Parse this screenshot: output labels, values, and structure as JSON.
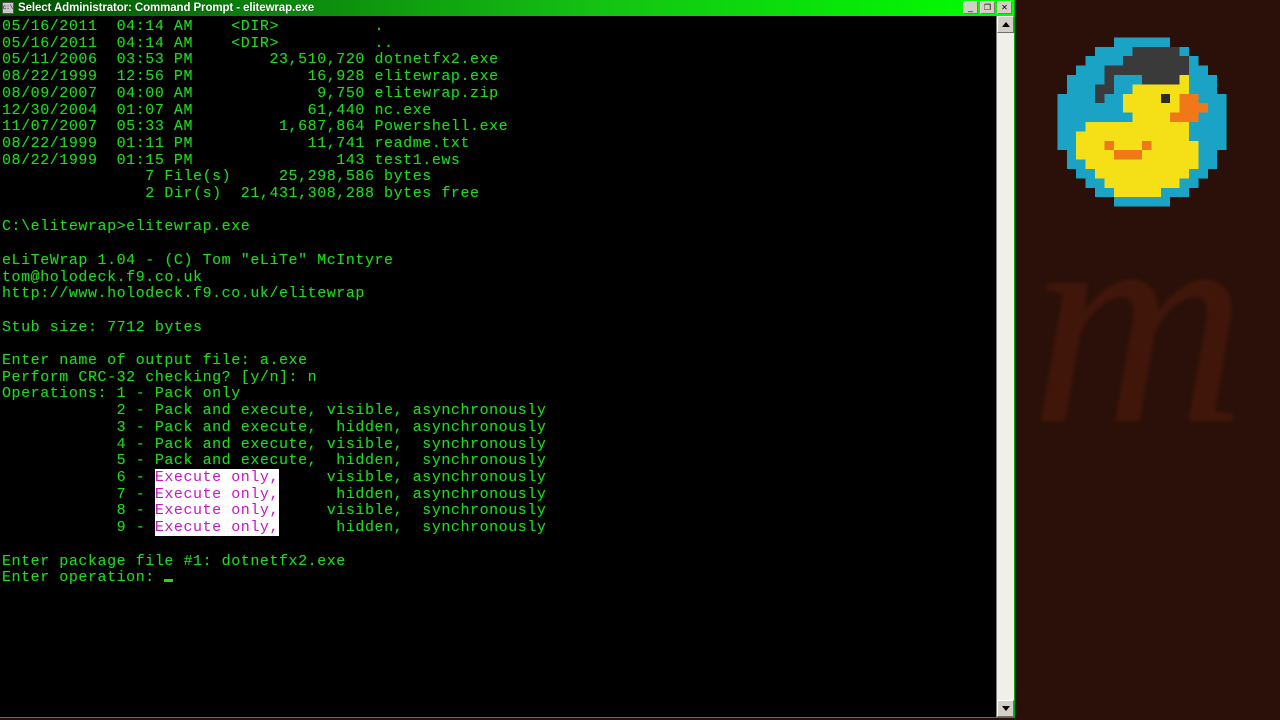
{
  "window": {
    "title": "Select Administrator: Command Prompt - elitewrap.exe",
    "icon": "console-icon",
    "controls": {
      "minimize": "_",
      "restore": "❐",
      "close": "✕"
    }
  },
  "console": {
    "background_color": "#000000",
    "text_color": "#1fd81f",
    "highlight_bg": "#ffffff",
    "highlight_fg": "#c515c5",
    "dir_listing": [
      "05/16/2011  04:14 AM    <DIR>          .",
      "05/16/2011  04:14 AM    <DIR>          ..",
      "05/11/2006  03:53 PM        23,510,720 dotnetfx2.exe",
      "08/22/1999  12:56 PM            16,928 elitewrap.exe",
      "08/09/2007  04:00 AM             9,750 elitewrap.zip",
      "12/30/2004  01:07 AM            61,440 nc.exe",
      "11/07/2007  05:33 AM         1,687,864 Powershell.exe",
      "08/22/1999  01:11 PM            11,741 readme.txt",
      "08/22/1999  01:15 PM               143 test1.ews",
      "               7 File(s)     25,298,586 bytes",
      "               2 Dir(s)  21,431,308,288 bytes free"
    ],
    "prompt_line": "C:\\elitewrap>elitewrap.exe",
    "banner": [
      "eLiTeWrap 1.04 - (C) Tom \"eLiTe\" McIntyre",
      "tom@holodeck.f9.co.uk",
      "http://www.holodeck.f9.co.uk/elitewrap"
    ],
    "stub_size": "Stub size: 7712 bytes",
    "output_file_line": "Enter name of output file: a.exe",
    "crc_line": "Perform CRC-32 checking? [y/n]: n",
    "operations_label": "Operations: ",
    "operations": [
      {
        "num": "1",
        "prefix": "Pack only",
        "suffix": "",
        "highlight": false
      },
      {
        "num": "2",
        "prefix": "Pack and execute,",
        "suffix": " visible, asynchronously",
        "highlight": false
      },
      {
        "num": "3",
        "prefix": "Pack and execute,",
        "suffix": "  hidden, asynchronously",
        "highlight": false
      },
      {
        "num": "4",
        "prefix": "Pack and execute,",
        "suffix": " visible,  synchronously",
        "highlight": false
      },
      {
        "num": "5",
        "prefix": "Pack and execute,",
        "suffix": "  hidden,  synchronously",
        "highlight": false
      },
      {
        "num": "6",
        "prefix": "Execute only,",
        "suffix": "     visible, asynchronously",
        "highlight": true
      },
      {
        "num": "7",
        "prefix": "Execute only,",
        "suffix": "      hidden, asynchronously",
        "highlight": true
      },
      {
        "num": "8",
        "prefix": "Execute only,",
        "suffix": "     visible,  synchronously",
        "highlight": true
      },
      {
        "num": "9",
        "prefix": "Execute only,",
        "suffix": "      hidden,  synchronously",
        "highlight": true
      }
    ],
    "package_file_line": "Enter package file #1: dotnetfx2.exe",
    "operation_prompt": "Enter operation: "
  },
  "scrollbar": {
    "up_arrow": "scroll-up-arrow",
    "down_arrow": "scroll-down-arrow"
  },
  "decor": {
    "watermark_text": "m",
    "watermark_color": "#45180c",
    "background_color": "#2a1008",
    "logo": {
      "name": "pixel-duck-graduate-logo",
      "circle_color": "#1aa3c4",
      "body_color": "#f5e017",
      "beak_color": "#f07818",
      "cap_color": "#3a3a3a",
      "outline_color": "#9e9200"
    }
  }
}
